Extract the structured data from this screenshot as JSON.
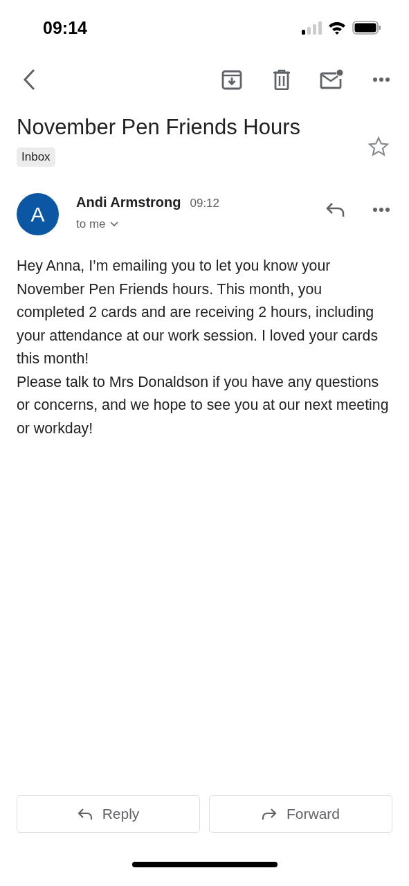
{
  "status_bar": {
    "time": "09:14"
  },
  "subject": "November Pen Friends Hours",
  "label": "Inbox",
  "starred": false,
  "message": {
    "avatar_letter": "A",
    "sender": "Andi Armstrong",
    "time": "09:12",
    "recipient": "to me",
    "body": [
      "Hey Anna, I’m emailing you to let you know your November Pen Friends hours. This month, you completed 2 cards and are receiving 2 hours, including your attendance at our work session. I loved your cards this month!",
      "Please talk to Mrs Donaldson if you have any questions or concerns, and we hope to see you at our next meeting or workday!"
    ]
  },
  "actions": [
    "Reply",
    "Forward"
  ]
}
